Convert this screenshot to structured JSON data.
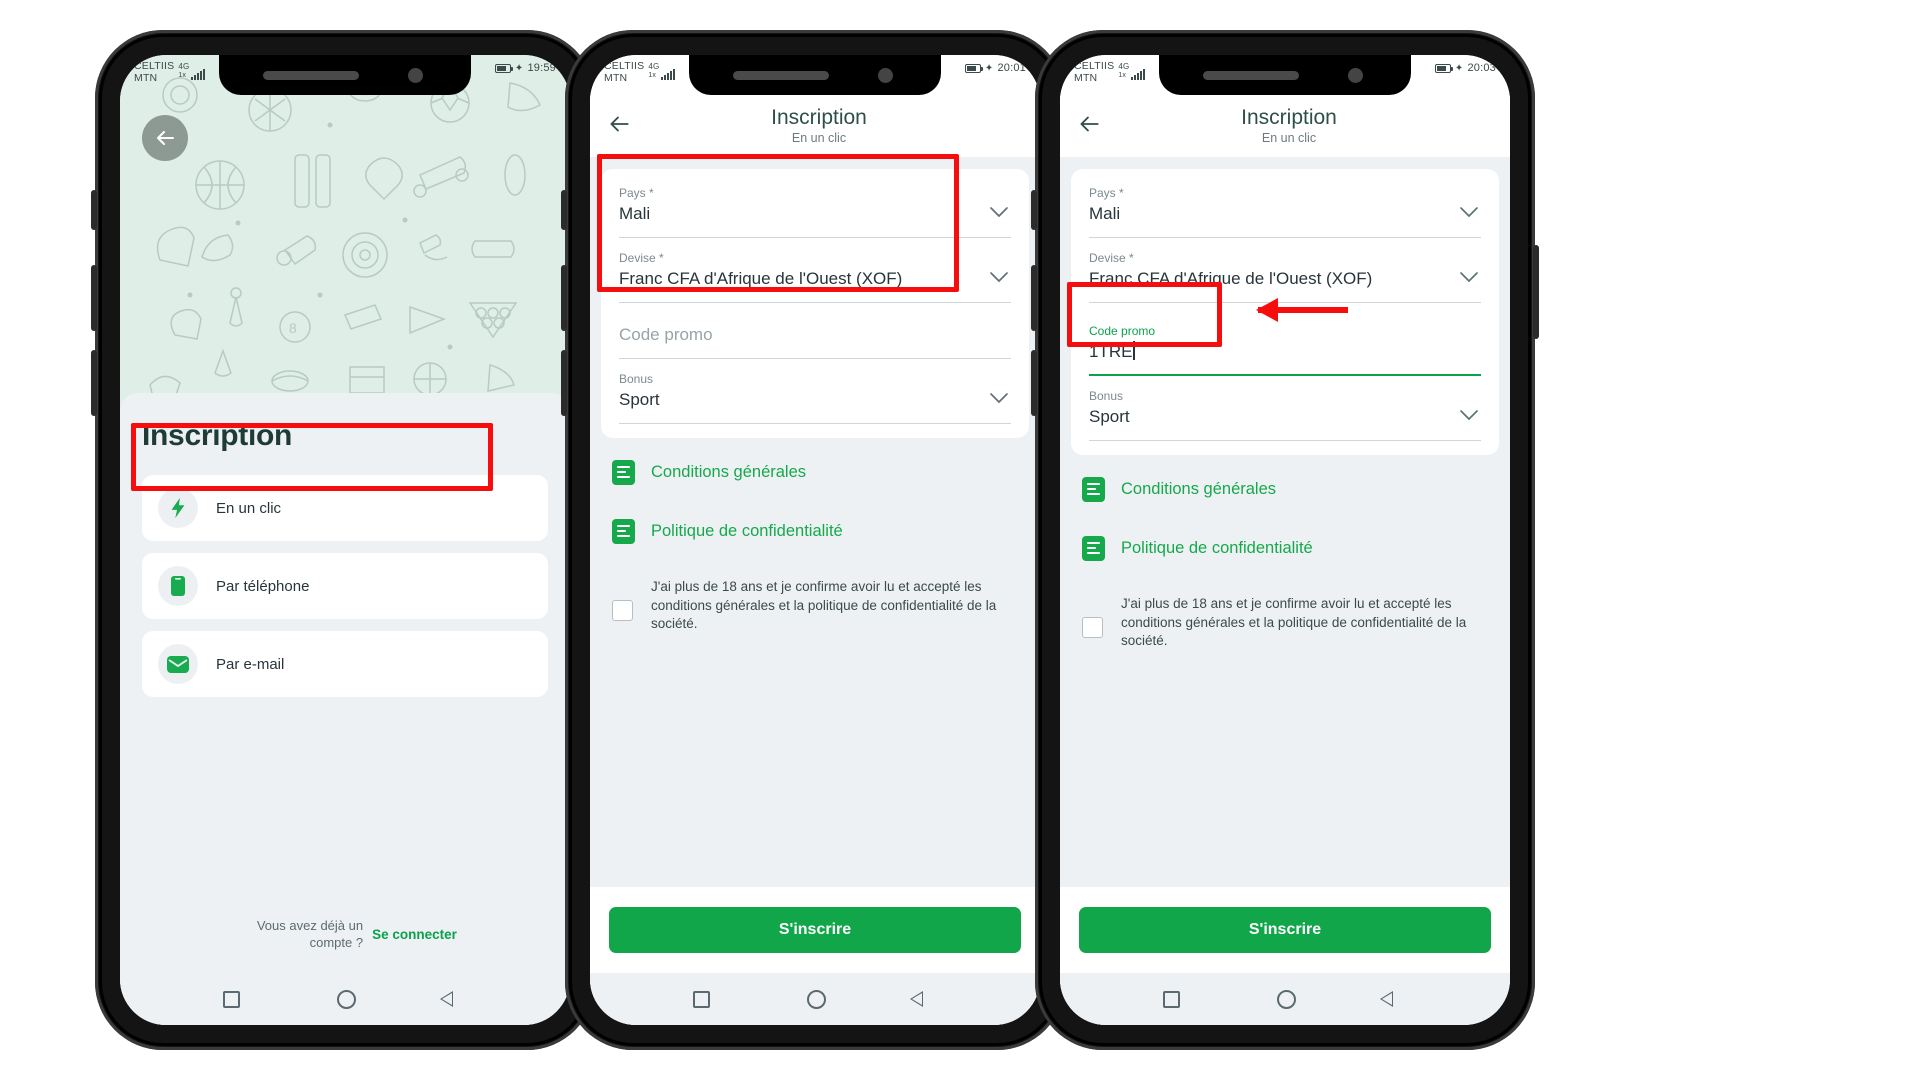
{
  "phones": [
    {
      "status": {
        "carrier_line1": "CELTIIS",
        "carrier_line2": "MTN",
        "net": "4G",
        "net2": "1x",
        "time": "19:59",
        "battery": "2"
      },
      "back_icon": "arrow-left-icon",
      "title": "Inscription",
      "options": [
        {
          "icon": "bolt-icon",
          "label": "En un clic"
        },
        {
          "icon": "phone-icon",
          "label": "Par téléphone"
        },
        {
          "icon": "envelope-icon",
          "label": "Par e-mail"
        }
      ],
      "footer": {
        "question": "Vous avez déjà un compte ?",
        "link": "Se connecter"
      }
    },
    {
      "status": {
        "carrier_line1": "CELTIIS",
        "carrier_line2": "MTN",
        "net": "4G",
        "net2": "1x",
        "time": "20:01",
        "battery": "3"
      },
      "appbar": {
        "back_icon": "arrow-left-icon",
        "title": "Inscription",
        "subtitle": "En un clic"
      },
      "fields": [
        {
          "label": "Pays *",
          "value": "Mali",
          "type": "select"
        },
        {
          "label": "Devise *",
          "value": "Franc CFA d'Afrique de l'Ouest (XOF)",
          "type": "select"
        },
        {
          "label": "",
          "placeholder": "Code promo",
          "value": "",
          "type": "text"
        },
        {
          "label": "Bonus",
          "value": "Sport",
          "type": "select"
        }
      ],
      "links": [
        {
          "icon": "document-icon",
          "label": "Conditions générales"
        },
        {
          "icon": "document-icon",
          "label": "Politique de confidentialité"
        }
      ],
      "agreement": "J'ai plus de 18 ans et je confirme avoir lu et accepté les conditions générales et la politique de confidentialité de la société.",
      "submit": "S'inscrire"
    },
    {
      "status": {
        "carrier_line1": "CELTIIS",
        "carrier_line2": "MTN",
        "net": "4G",
        "net2": "1x",
        "time": "20:03",
        "battery": "3"
      },
      "appbar": {
        "back_icon": "arrow-left-icon",
        "title": "Inscription",
        "subtitle": "En un clic"
      },
      "fields": [
        {
          "label": "Pays *",
          "value": "Mali",
          "type": "select"
        },
        {
          "label": "Devise *",
          "value": "Franc CFA d'Afrique de l'Ouest (XOF)",
          "type": "select"
        },
        {
          "label": "Code promo",
          "value": "1TRE",
          "type": "text_focused"
        },
        {
          "label": "Bonus",
          "value": "Sport",
          "type": "select"
        }
      ],
      "links": [
        {
          "icon": "document-icon",
          "label": "Conditions générales"
        },
        {
          "icon": "document-icon",
          "label": "Politique de confidentialité"
        }
      ],
      "agreement": "J'ai plus de 18 ans et je confirme avoir lu et accepté les conditions générales et la politique de confidentialité de la société.",
      "submit": "S'inscrire"
    }
  ],
  "colors": {
    "accent_green": "#11a64a",
    "link_green": "#15a94c",
    "annotation_red": "#f60d0d",
    "hero_bg": "#dfeee7",
    "sheet_bg": "#eef1f4"
  },
  "navbar": {
    "recent": "square-icon",
    "home": "circle-icon",
    "back": "triangle-back-icon"
  }
}
